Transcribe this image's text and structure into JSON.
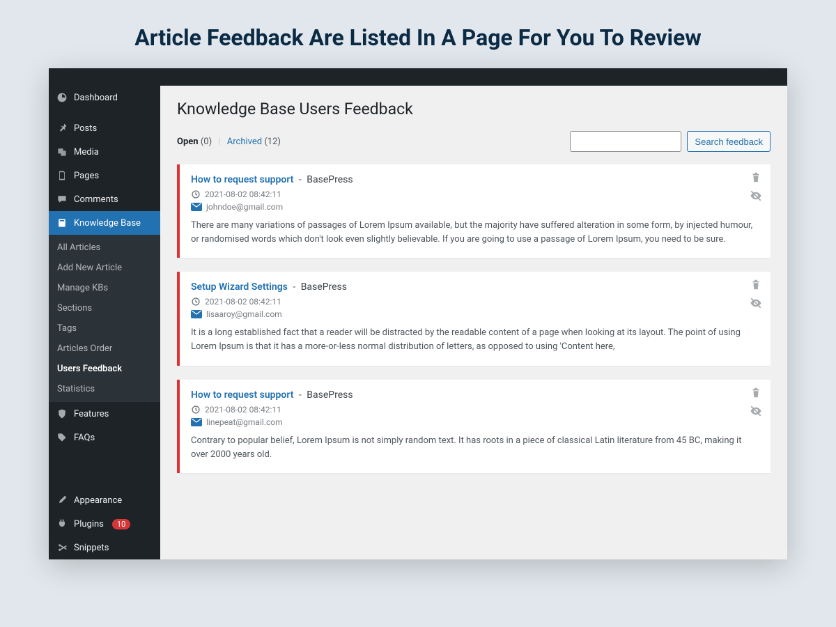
{
  "page_heading": "Article Feedback Are Listed In A Page For You To Review",
  "sidebar": {
    "items": [
      {
        "label": "Dashboard",
        "icon": "dashboard-icon"
      },
      {
        "label": "Posts",
        "icon": "pin-icon"
      },
      {
        "label": "Media",
        "icon": "media-icon"
      },
      {
        "label": "Pages",
        "icon": "page-icon"
      },
      {
        "label": "Comments",
        "icon": "comment-icon"
      },
      {
        "label": "Knowledge Base",
        "icon": "book-icon",
        "active": true
      },
      {
        "label": "Features",
        "icon": "shield-icon"
      },
      {
        "label": "FAQs",
        "icon": "tag-icon"
      },
      {
        "label": "Appearance",
        "icon": "brush-icon"
      },
      {
        "label": "Plugins",
        "icon": "plug-icon",
        "badge": "10"
      },
      {
        "label": "Snippets",
        "icon": "scissors-icon"
      }
    ],
    "submenu": [
      {
        "label": "All Articles"
      },
      {
        "label": "Add New Article"
      },
      {
        "label": "Manage KBs"
      },
      {
        "label": "Sections"
      },
      {
        "label": "Tags"
      },
      {
        "label": "Articles Order"
      },
      {
        "label": "Users Feedback",
        "current": true
      },
      {
        "label": "Statistics"
      }
    ]
  },
  "content": {
    "title": "Knowledge Base Users Feedback",
    "tabs": {
      "open_label": "Open",
      "open_count": "(0)",
      "archived_label": "Archived",
      "archived_count": "(12)"
    },
    "search": {
      "placeholder": "",
      "button": "Search feedback"
    },
    "cards": [
      {
        "article": "How to request support",
        "source": "BasePress",
        "time": "2021-08-02 08:42:11",
        "email": "johndoe@gmail.com",
        "body": "There are many variations of passages of Lorem Ipsum available, but the majority have suffered alteration in some form, by injected humour, or randomised words which don't look even slightly believable. If you are going to use a passage of Lorem Ipsum, you need to be sure."
      },
      {
        "article": "Setup Wizard Settings",
        "source": "BasePress",
        "time": "2021-08-02 08:42:11",
        "email": "lisaaroy@gmail.com",
        "body": "It is a long established fact that a reader will be distracted by the readable content of a page when looking at its layout. The point of using Lorem Ipsum is that it has a more-or-less normal distribution of letters, as opposed to using 'Content here,"
      },
      {
        "article": "How to request support",
        "source": "BasePress",
        "time": "2021-08-02 08:42:11",
        "email": "linepeat@gmail.com",
        "body": "Contrary to popular belief, Lorem Ipsum is not simply random text. It has roots in a piece of classical Latin literature from 45 BC, making it over 2000 years old."
      }
    ]
  },
  "colors": {
    "accent": "#2271b1",
    "danger": "#dc3232"
  }
}
